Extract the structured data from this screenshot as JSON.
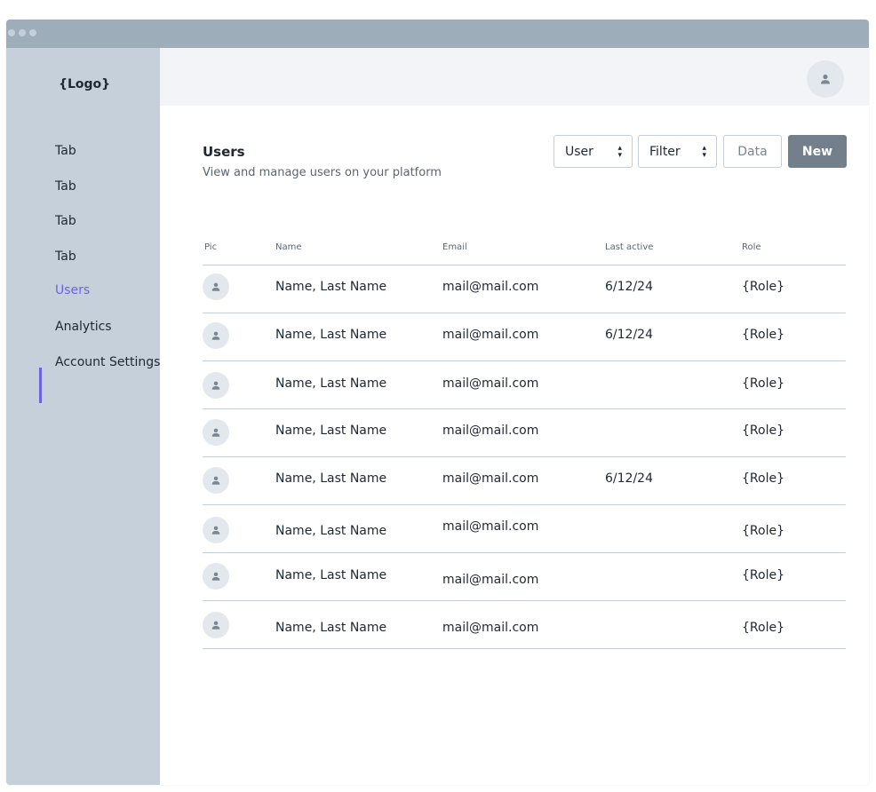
{
  "window": {
    "dots": 3
  },
  "sidebar": {
    "logo": "{Logo}",
    "items": [
      {
        "label": "Tab"
      },
      {
        "label": "Tab"
      },
      {
        "label": "Tab"
      },
      {
        "label": "Tab"
      },
      {
        "label": "Users",
        "active": true
      },
      {
        "label": "Analytics"
      },
      {
        "label": "Account Settings"
      }
    ]
  },
  "topbar": {
    "avatar_icon": "user-icon"
  },
  "main": {
    "title": "Users",
    "subtitle": "View and manage users on your platform",
    "user_select": {
      "value": "User"
    },
    "filter_select": {
      "value": "Filter"
    },
    "data_button": "Data",
    "new_button": "New"
  },
  "table": {
    "columns": [
      "Pic",
      "Name",
      "Email",
      "Last active",
      "Role"
    ],
    "rows": [
      {
        "name": "Name, Last Name",
        "email": "mail@mail.com",
        "last_active": "6/12/24",
        "role": "{Role}"
      },
      {
        "name": "Name, Last Name",
        "email": "mail@mail.com",
        "last_active": "6/12/24",
        "role": "{Role}"
      },
      {
        "name": "Name, Last Name",
        "email": "mail@mail.com",
        "last_active": "",
        "role": "{Role}"
      },
      {
        "name": "Name, Last Name",
        "email": "mail@mail.com",
        "last_active": "",
        "role": "{Role}"
      },
      {
        "name": "Name, Last Name",
        "email": "mail@mail.com",
        "last_active": "6/12/24",
        "role": "{Role}"
      },
      {
        "name": "Name, Last Name",
        "email": "mail@mail.com",
        "last_active": "",
        "role": "{Role}"
      },
      {
        "name": "Name, Last Name",
        "email": "mail@mail.com",
        "last_active": "",
        "role": "{Role}"
      },
      {
        "name": "Name, Last Name",
        "email": "mail@mail.com",
        "last_active": "",
        "role": "{Role}"
      }
    ]
  },
  "colors": {
    "accent": "#6b63e6",
    "sidebar_bg": "#c5d0da",
    "titlebar_bg": "#9eadba",
    "primary_button": "#747f8c"
  }
}
